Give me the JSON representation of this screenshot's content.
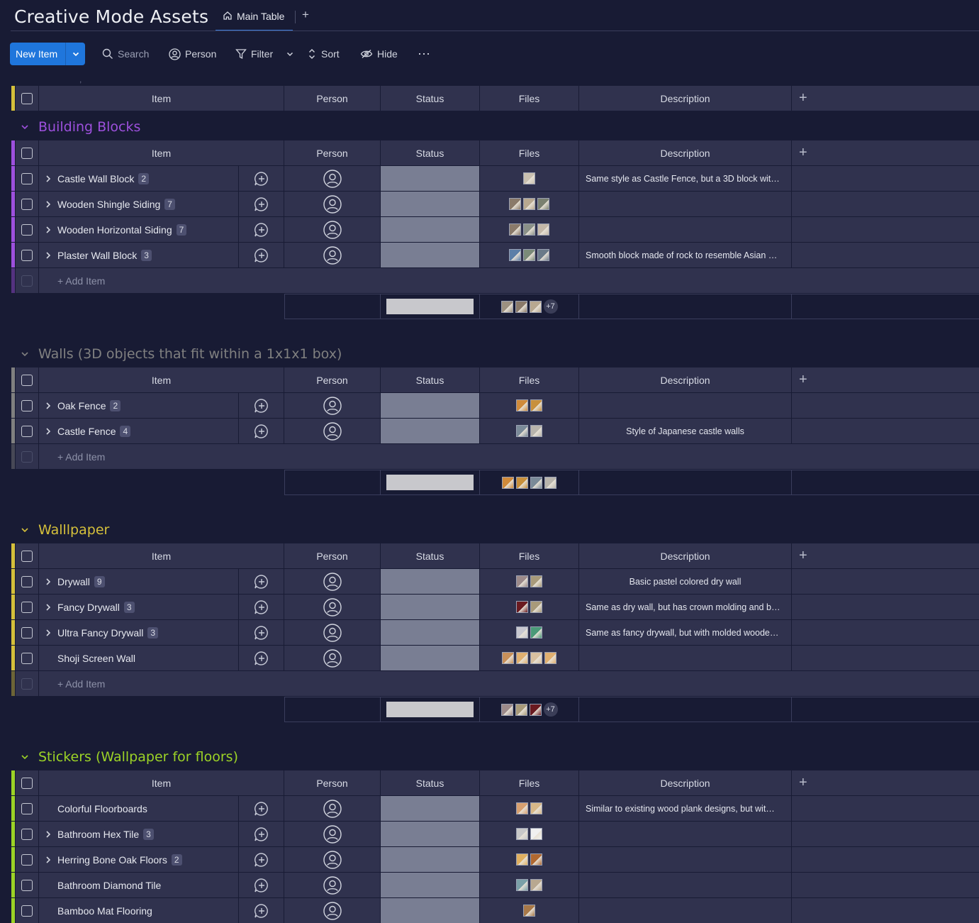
{
  "header": {
    "board_title": "Creative Mode Assets",
    "tab_main": "Main Table",
    "tab_add": "+"
  },
  "toolbar": {
    "new_item": "New Item",
    "search": "Search",
    "person": "Person",
    "filter": "Filter",
    "sort": "Sort",
    "hide": "Hide",
    "more": "⋯"
  },
  "columns": {
    "item": "Item",
    "person": "Person",
    "status": "Status",
    "files": "Files",
    "description": "Description",
    "add": "+"
  },
  "add_item_label": "+ Add Item",
  "groups": [
    {
      "title": "Building Blocks",
      "color": "#9d50dd",
      "rows": [
        {
          "name": "Castle Wall Block",
          "count": "2",
          "expand": true,
          "desc": "Same style as Castle Fence, but a 3D block wit…",
          "files": [
            "#c9c0b0"
          ]
        },
        {
          "name": "Wooden Shingle Siding",
          "count": "7",
          "expand": true,
          "desc": "",
          "files": [
            "#8a7a6a",
            "#b8a890",
            "#7a8070"
          ]
        },
        {
          "name": "Wooden Horizontal Siding",
          "count": "7",
          "expand": true,
          "desc": "",
          "files": [
            "#8a7a6a",
            "#8a9088",
            "#c4b8a8"
          ]
        },
        {
          "name": "Plaster Wall Block",
          "count": "3",
          "expand": true,
          "desc": "Smooth block made of rock to resemble Asian …",
          "files": [
            "#5a7fa8",
            "#7a8a78",
            "#6a7a88"
          ]
        }
      ],
      "summary_files": [
        "#9c9080",
        "#8a7a6a",
        "#b8a890"
      ],
      "summary_more": "+7"
    },
    {
      "title": "Walls (3D objects that fit within a 1x1x1 box)",
      "color": "#808080",
      "rows": [
        {
          "name": "Oak Fence",
          "count": "2",
          "expand": true,
          "desc": "",
          "files": [
            "#d08a3a",
            "#c8903c"
          ]
        },
        {
          "name": "Castle Fence",
          "count": "4",
          "expand": true,
          "desc": "Style of Japanese castle walls",
          "desc_center": true,
          "files": [
            "#7a8a98",
            "#b8b4ac"
          ]
        }
      ],
      "summary_files": [
        "#d08a3a",
        "#c8903c",
        "#7a8a98",
        "#b8b4ac"
      ],
      "summary_more": ""
    },
    {
      "title": "Walllpaper",
      "color": "#d5c03b",
      "rows": [
        {
          "name": "Drywall",
          "count": "9",
          "expand": true,
          "desc": "Basic pastel colored dry wall",
          "desc_center": true,
          "files": [
            "#9c8a8a",
            "#a89a7a"
          ]
        },
        {
          "name": "Fancy Drywall",
          "count": "3",
          "expand": true,
          "desc": "Same as dry wall, but has crown molding and b…",
          "files": [
            "#6a1a20",
            "#a89a7a"
          ]
        },
        {
          "name": "Ultra Fancy Drywall",
          "count": "3",
          "expand": true,
          "desc": "Same as fancy drywall, but with molded woode…",
          "files": [
            "#c8c8d0",
            "#4a9a78"
          ]
        },
        {
          "name": "Shoji Screen Wall",
          "count": "",
          "expand": false,
          "desc": "",
          "files": [
            "#c8905a",
            "#e0b070",
            "#d8c0a0",
            "#e0b070"
          ]
        }
      ],
      "summary_files": [
        "#9c8a8a",
        "#a89a7a",
        "#6a1a20"
      ],
      "summary_more": "+7"
    },
    {
      "title": "Stickers (Wallpaper for floors)",
      "color": "#9cd326",
      "rows": [
        {
          "name": "Colorful Floorboards",
          "count": "",
          "expand": false,
          "desc": "Similar to existing wood plank designs, but wit…",
          "files": [
            "#d8a070",
            "#d8b888"
          ]
        },
        {
          "name": "Bathroom Hex Tile",
          "count": "3",
          "expand": true,
          "desc": "",
          "files": [
            "#c8c8c8",
            "#f0f0f0"
          ]
        },
        {
          "name": "Herring Bone Oak Floors",
          "count": "2",
          "expand": true,
          "desc": "",
          "files": [
            "#e0b060",
            "#b06830"
          ]
        },
        {
          "name": "Bathroom Diamond Tile",
          "count": "",
          "expand": false,
          "desc": "",
          "files": [
            "#7aa0a8",
            "#b8a890"
          ]
        },
        {
          "name": "Bamboo Mat Flooring",
          "count": "",
          "expand": false,
          "desc": "",
          "files": [
            "#a87848"
          ]
        }
      ],
      "summary_files": [],
      "summary_more": ""
    }
  ]
}
